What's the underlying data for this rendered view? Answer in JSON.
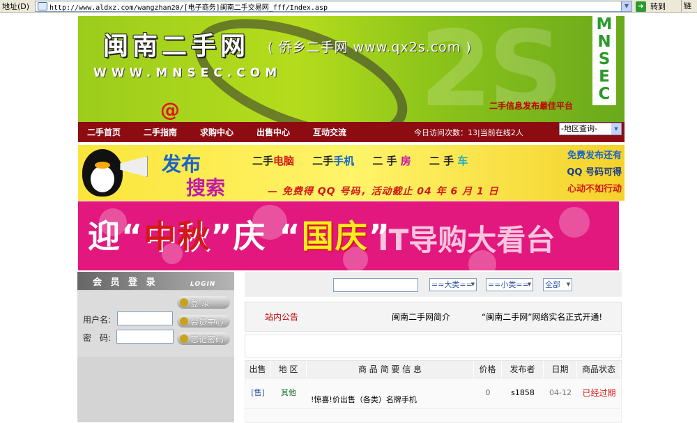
{
  "browser": {
    "address_label": "地址(D)",
    "url": "http://www.aldxz.com/wangzhan20/[电子商务]闽南二手交易网_fff/Index.asp",
    "go_label": "转到",
    "links_label": "链接"
  },
  "header": {
    "title": "闽南二手网",
    "subtitle": "( 侨乡二手网 www.qx2s.com )",
    "domain": "WWW.MNSEC.COM",
    "at_symbol": "@",
    "side_mark": [
      "M",
      "N",
      "S",
      "E",
      "C"
    ],
    "slogan": "二手信息发布最佳平台",
    "watermark": "2S"
  },
  "nav": {
    "items": [
      "二手首页",
      "二手指南",
      "求购中心",
      "出售中心",
      "互动交流"
    ],
    "visit_text": "今日访问次数：13|当前在线2人",
    "region_select": "-地区查询-"
  },
  "ad1": {
    "publish": "发布",
    "search": "搜索",
    "items": [
      {
        "pre": "二手",
        "hl": "电脑"
      },
      {
        "pre": "二手",
        "hl": "手机"
      },
      {
        "pre": "二 手 ",
        "hl": "房"
      },
      {
        "pre": "二 手 ",
        "hl": "车"
      }
    ],
    "bottom": "— 免费得 QQ 号码，活动截止 04 年 6 月 1 日",
    "right_lines": [
      "免费发布还有",
      "QQ 号码可得",
      "心动不如行动"
    ],
    "right_colors": [
      "#1a64c8",
      "#1a64c8",
      "#d41a1a"
    ]
  },
  "ad2": {
    "text_a": "迎“",
    "text_b": "中秋",
    "text_c": "”庆 “",
    "text_d": "国庆",
    "text_e": "”",
    "guide": "IT导购大看台"
  },
  "login": {
    "title": "会 员 登 录",
    "title_en": "LOGIN",
    "username_label": "用户名:",
    "password_label": "密　码:",
    "btn_login": "登  录",
    "btn_member": "会员中心",
    "btn_forgot": "忘记密码"
  },
  "search": {
    "big_category": "==大类==",
    "small_category": "==小类==",
    "all": "全部"
  },
  "notice": {
    "label": "站内公告",
    "item1": "闽南二手网简介",
    "item2": "“闽南二手网”网络实名正式开通!"
  },
  "table": {
    "headers": [
      "出售",
      "地 区",
      "商 品 简 要 信 息",
      "价格",
      "发布者",
      "日期",
      "商品状态"
    ],
    "rows": [
      {
        "type": "[售]",
        "region": "其他",
        "info": "!惊喜!价出售（各类）名牌手机",
        "price": "0",
        "poster": "s1858",
        "date": "04-12",
        "status": "已经过期"
      }
    ]
  },
  "colors": {
    "nav_bg": "#8c0c12",
    "expired": "#d4181a",
    "region_link": "#1a6a2a",
    "sale_tag": "#2e50a0"
  }
}
